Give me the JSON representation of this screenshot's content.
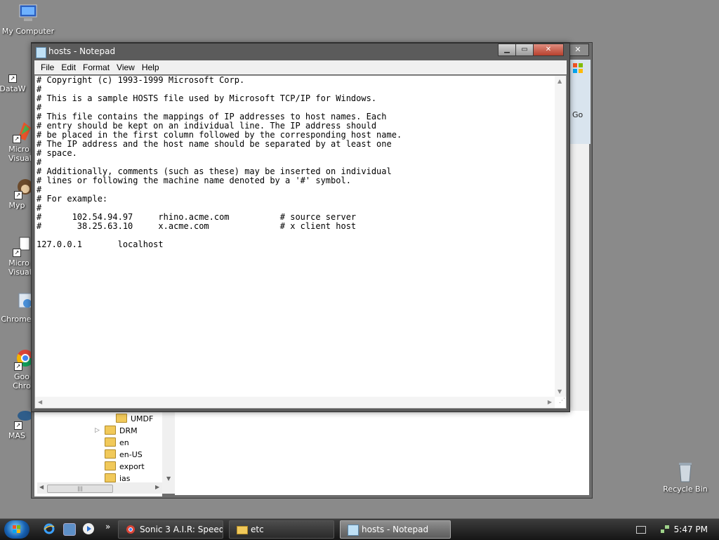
{
  "desktop": {
    "icons": [
      {
        "label": "My Computer"
      },
      {
        "label": "DataW"
      },
      {
        "label": "Micro Visual"
      },
      {
        "label": "Myp"
      },
      {
        "label": "Micro Visual"
      },
      {
        "label": "Chrome"
      },
      {
        "label": "Goo Chro"
      },
      {
        "label": "MAS"
      },
      {
        "label": "Recycle Bin"
      }
    ]
  },
  "explorer": {
    "go_label": "Go",
    "tree_items": [
      "UMDF",
      "DRM",
      "en",
      "en-US",
      "export",
      "ias"
    ]
  },
  "notepad": {
    "title": "hosts - Notepad",
    "menu": [
      "File",
      "Edit",
      "Format",
      "View",
      "Help"
    ],
    "content": "# Copyright (c) 1993-1999 Microsoft Corp.\n#\n# This is a sample HOSTS file used by Microsoft TCP/IP for Windows.\n#\n# This file contains the mappings of IP addresses to host names. Each\n# entry should be kept on an individual line. The IP address should\n# be placed in the first column followed by the corresponding host name.\n# The IP address and the host name should be separated by at least one\n# space.\n#\n# Additionally, comments (such as these) may be inserted on individual\n# lines or following the machine name denoted by a '#' symbol.\n#\n# For example:\n#\n#      102.54.94.97     rhino.acme.com          # source server\n#       38.25.63.10     x.acme.com              # x client host\n\n127.0.0.1       localhost\n"
  },
  "taskbar": {
    "tasks": [
      {
        "label": "Sonic 3 A.I.R: Speed..."
      },
      {
        "label": "etc"
      },
      {
        "label": "hosts - Notepad"
      }
    ],
    "clock": "5:47 PM"
  },
  "colors": {
    "desktop_bg": "#8a8a8a",
    "window_frame": "#5b5b5b",
    "close_button": "#c14b38",
    "folder": "#f1c95a"
  }
}
